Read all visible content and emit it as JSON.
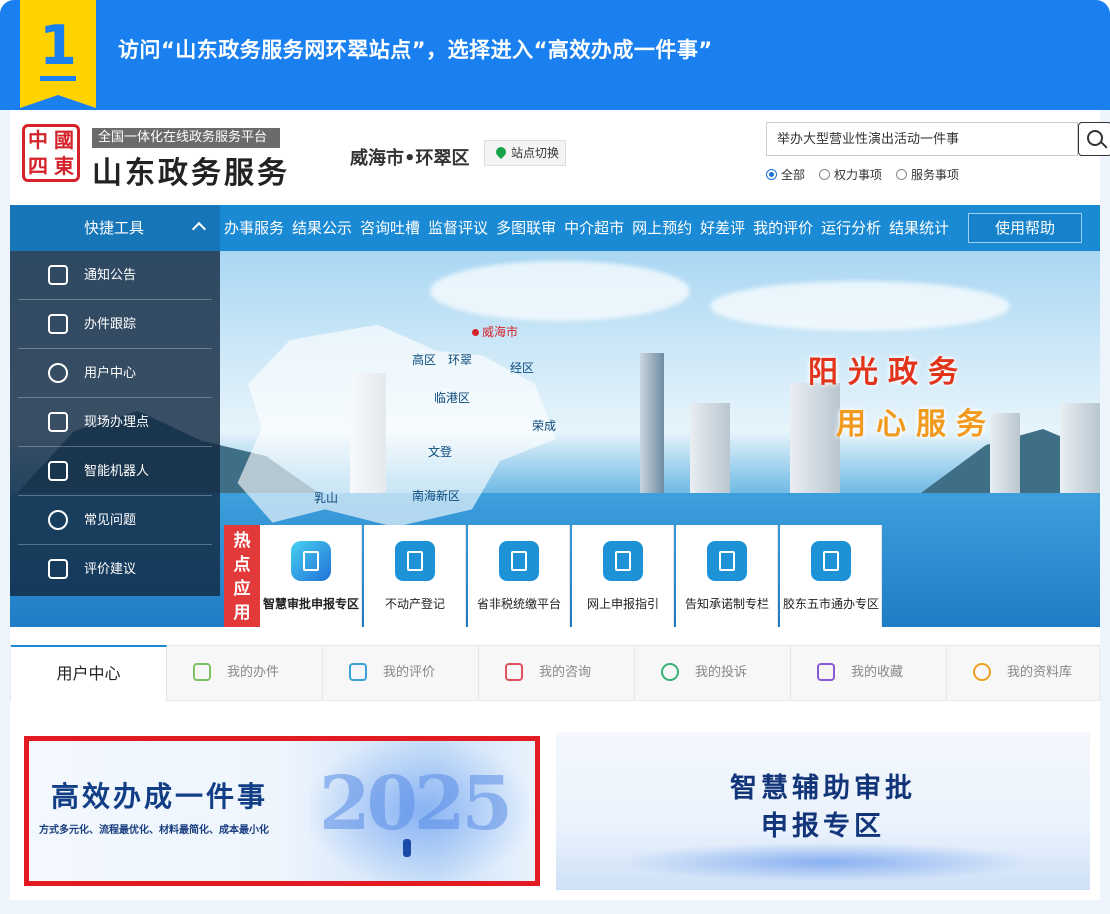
{
  "instruction": {
    "step": "1",
    "text": "访问“山东政务服务网环翠站点”，选择进入“高效办成一件事”"
  },
  "header": {
    "logo_seal": [
      "中",
      "國",
      "四",
      "東"
    ],
    "logo_subtitle": "全国一体化在线政务服务平台",
    "logo_title": "山东政务服务",
    "city": "威海市•环翠区",
    "site_switch": "站点切换",
    "search_value": "举办大型营业性演出活动一件事",
    "radios": [
      {
        "label": "全部",
        "checked": true
      },
      {
        "label": "权力事项",
        "checked": false
      },
      {
        "label": "服务事项",
        "checked": false
      }
    ]
  },
  "nav": {
    "quick_tools": "快捷工具",
    "items": [
      "办事服务",
      "结果公示",
      "咨询吐槽",
      "监督评议",
      "多图联审",
      "中介超市",
      "网上预约",
      "好差评",
      "我的评价",
      "运行分析",
      "结果统计"
    ],
    "help": "使用帮助"
  },
  "sidebar": {
    "items": [
      {
        "label": "通知公告",
        "icon": "speaker-icon"
      },
      {
        "label": "办件跟踪",
        "icon": "paper-plane-icon"
      },
      {
        "label": "用户中心",
        "icon": "user-icon"
      },
      {
        "label": "现场办理点",
        "icon": "stamp-icon"
      },
      {
        "label": "智能机器人",
        "icon": "robot-icon"
      },
      {
        "label": "常见问题",
        "icon": "question-icon"
      },
      {
        "label": "评价建议",
        "icon": "edit-icon"
      }
    ]
  },
  "hero": {
    "slogan1": "阳光政务",
    "slogan2": "用心服务",
    "map_labels": [
      "威海市",
      "高区",
      "环翠",
      "经区",
      "临港区",
      "荣成",
      "文登",
      "乳山",
      "南海新区"
    ]
  },
  "hot_apps": {
    "tag": "热点应用",
    "items": [
      "智慧审批申报专区",
      "不动产登记",
      "省非税统缴平台",
      "网上申报指引",
      "告知承诺制专栏",
      "胶东五市通办专区"
    ]
  },
  "user_center": {
    "title": "用户中心",
    "tabs": [
      {
        "label": "我的办件",
        "icon": "pencil-icon",
        "color": "#7cc36a"
      },
      {
        "label": "我的评价",
        "icon": "medal-icon",
        "color": "#3aa0d8"
      },
      {
        "label": "我的咨询",
        "icon": "chat-icon",
        "color": "#e0505a"
      },
      {
        "label": "我的投诉",
        "icon": "phone-icon",
        "color": "#3bb07a"
      },
      {
        "label": "我的收藏",
        "icon": "star-icon",
        "color": "#8a5bd6"
      },
      {
        "label": "我的资料库",
        "icon": "person-icon",
        "color": "#f0a020"
      }
    ]
  },
  "promos": {
    "left_title": "高效办成一件事",
    "left_sub": "方式多元化、流程最优化、材料最简化、成本最小化",
    "left_year": "2025",
    "right_title_1": "智慧辅助审批",
    "right_title_2": "申报专区"
  },
  "colors": {
    "banner": "#1a80f0",
    "badge": "#ffd200",
    "nav": "#1a8ad4",
    "highlight": "#e21b23"
  }
}
